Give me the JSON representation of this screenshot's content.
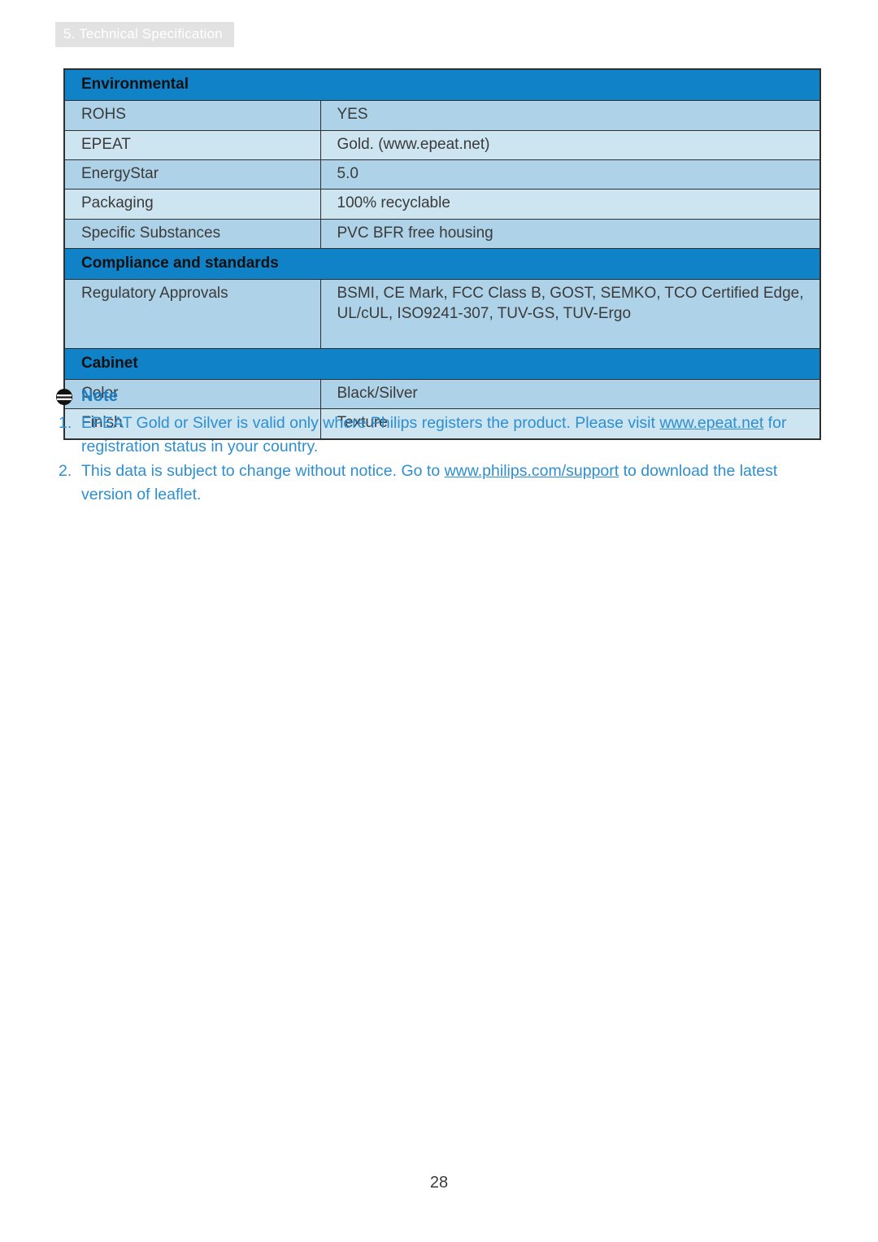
{
  "header": {
    "tab_label": "5. Technical Specification"
  },
  "table": {
    "sections": [
      {
        "title": "Environmental",
        "rows": [
          {
            "label": "ROHS",
            "value": "YES"
          },
          {
            "label": "EPEAT",
            "value": "Gold. (www.epeat.net)"
          },
          {
            "label": "EnergyStar",
            "value": "5.0"
          },
          {
            "label": "Packaging",
            "value": "100% recyclable"
          },
          {
            "label": "Specific Substances",
            "value": "PVC BFR free housing"
          }
        ]
      },
      {
        "title": "Compliance and standards",
        "rows": [
          {
            "label": "Regulatory Approvals",
            "value": "BSMI, CE Mark, FCC Class B, GOST, SEMKO, TCO Certified Edge, UL/cUL, ISO9241-307, TUV-GS, TUV-Ergo"
          }
        ]
      },
      {
        "title": "Cabinet",
        "rows": [
          {
            "label": "Color",
            "value": "Black/Silver"
          },
          {
            "label": "Finish",
            "value": "Texture"
          }
        ]
      }
    ]
  },
  "note": {
    "icon": "note-icon",
    "title": "Note",
    "items": [
      {
        "number": "1.",
        "text_before": "EPEAT Gold or Silver is valid only where Philips registers the product. Please visit ",
        "link": "www.epeat.net",
        "text_after": " for registration status in your country."
      },
      {
        "number": "2.",
        "text_before": "This data is subject to change without notice. Go to ",
        "link": "www.philips.com/support",
        "text_after": " to download the latest version of leaflet."
      }
    ]
  },
  "footer": {
    "page_number": "28"
  },
  "colors": {
    "section_header_bg": "#0f82c8",
    "row_a_bg": "#aed2e7",
    "row_b_bg": "#cde4f1",
    "note_blue": "#2d8fd0",
    "tab_bg": "#e2e2e2",
    "border": "#2f2f2f"
  }
}
